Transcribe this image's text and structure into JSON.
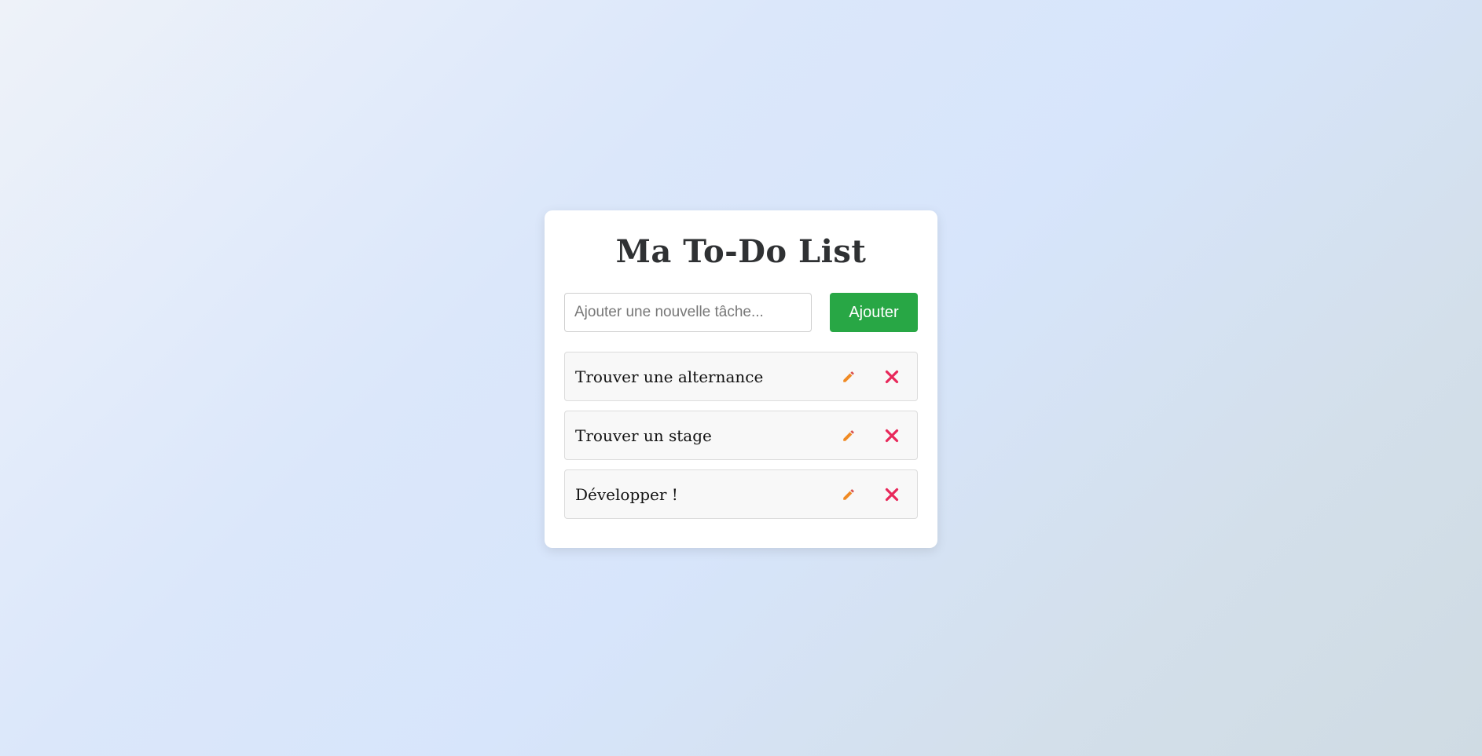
{
  "app": {
    "title": "Ma To-Do List"
  },
  "add_form": {
    "placeholder": "Ajouter une nouvelle tâche...",
    "value": "",
    "button_label": "Ajouter"
  },
  "tasks": [
    {
      "text": "Trouver une alternance",
      "edit_icon": "pencil-icon",
      "delete_icon": "close-icon"
    },
    {
      "text": "Trouver un stage",
      "edit_icon": "pencil-icon",
      "delete_icon": "close-icon"
    },
    {
      "text": "Développer !",
      "edit_icon": "pencil-icon",
      "delete_icon": "close-icon"
    }
  ],
  "colors": {
    "accent": "#28a745",
    "edit_icon": "#f08a24",
    "delete_icon": "#e8285a",
    "title": "#2f3133"
  }
}
